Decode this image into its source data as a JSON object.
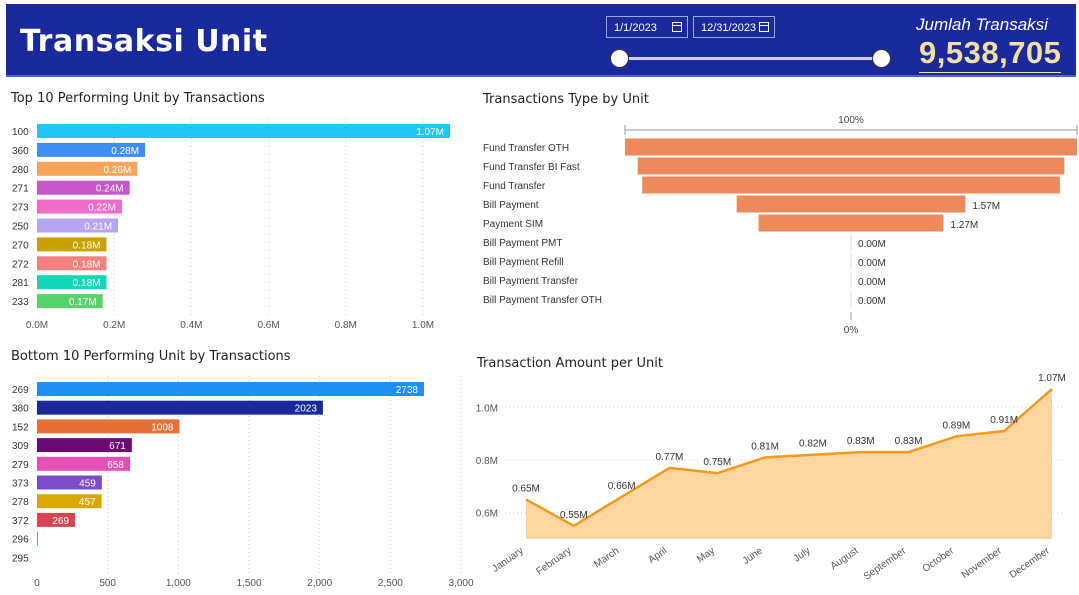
{
  "header": {
    "title": "Transaksi Unit",
    "date_start": "1/1/2023",
    "date_end": "12/31/2023",
    "kpi_label": "Jumlah Transaksi",
    "kpi_value": "9,538,705",
    "background": "#1a2a9c",
    "kpi_color": "#f4e1a1"
  },
  "chart_data": [
    {
      "type": "bar",
      "title": "Top 10 Performing Unit by Transactions",
      "orientation": "horizontal",
      "categories": [
        "100",
        "360",
        "280",
        "271",
        "273",
        "250",
        "270",
        "272",
        "281",
        "233"
      ],
      "values": [
        1.07,
        0.28,
        0.26,
        0.24,
        0.22,
        0.21,
        0.18,
        0.18,
        0.18,
        0.17
      ],
      "labels": [
        "1.07M",
        "0.28M",
        "0.26M",
        "0.24M",
        "0.22M",
        "0.21M",
        "0.18M",
        "0.18M",
        "0.18M",
        "0.17M"
      ],
      "colors": [
        "#1fc7f5",
        "#3d8ef0",
        "#f7a35a",
        "#c458c6",
        "#ee6dc9",
        "#b5a4f0",
        "#c9a200",
        "#f5817e",
        "#14d6b8",
        "#56d46a"
      ],
      "xlim": [
        0,
        1.07
      ],
      "xticks": [
        "0.0M",
        "0.2M",
        "0.4M",
        "0.6M",
        "0.8M",
        "1.0M"
      ],
      "xtick_values": [
        0,
        0.2,
        0.4,
        0.6,
        0.8,
        1.0
      ],
      "grid": true
    },
    {
      "type": "bar",
      "title": "Transactions Type by Unit",
      "orientation": "funnel",
      "categories": [
        "Fund Transfer OTH",
        "Fund Transfer BI Fast",
        "Fund Transfer",
        "Bill Payment",
        "Payment SIM",
        "Bill Payment PMT",
        "Bill Payment Refill",
        "Bill Payment Transfer",
        "Bill Payment Transfer OTH"
      ],
      "values": [
        100,
        94.4,
        92.4,
        50.6,
        40.9,
        0,
        0,
        0,
        0
      ],
      "labels": [
        "",
        "",
        "",
        "1.57M",
        "1.27M",
        "0.00M",
        "0.00M",
        "0.00M",
        "0.00M"
      ],
      "top_label": "100%",
      "bottom_label": "0%",
      "color": "#ec8a5c"
    },
    {
      "type": "bar",
      "title": "Bottom 10 Performing Unit by Transactions",
      "orientation": "horizontal",
      "categories": [
        "269",
        "380",
        "152",
        "309",
        "279",
        "373",
        "278",
        "372",
        "296",
        "295"
      ],
      "values": [
        2738,
        2023,
        1008,
        671,
        658,
        459,
        457,
        269,
        2,
        0
      ],
      "labels": [
        "2738",
        "2023",
        "1008",
        "671",
        "658",
        "459",
        "457",
        "269",
        "",
        ""
      ],
      "colors": [
        "#1d8ff5",
        "#1a2a9c",
        "#e8703a",
        "#6b0a73",
        "#e64fb5",
        "#7b4ec8",
        "#dba600",
        "#d94452",
        "#14c8b0",
        "#cccccc"
      ],
      "xlim": [
        0,
        3000
      ],
      "xticks": [
        "0",
        "500",
        "1,000",
        "1,500",
        "2,000",
        "2,500",
        "3,000"
      ],
      "xtick_values": [
        0,
        500,
        1000,
        1500,
        2000,
        2500,
        3000
      ],
      "grid": true
    },
    {
      "type": "area",
      "title": "Transaction Amount per Unit",
      "x": [
        "January",
        "February",
        "March",
        "April",
        "May",
        "June",
        "July",
        "August",
        "September",
        "October",
        "November",
        "December"
      ],
      "values": [
        0.65,
        0.55,
        0.66,
        0.77,
        0.75,
        0.81,
        0.82,
        0.83,
        0.83,
        0.89,
        0.91,
        1.07
      ],
      "labels": [
        "0.65M",
        "0.55M",
        "0.66M",
        "0.77M",
        "0.75M",
        "0.81M",
        "0.82M",
        "0.83M",
        "0.83M",
        "0.89M",
        "0.91M",
        "1.07M"
      ],
      "ylim": [
        0.5,
        1.1
      ],
      "yticks": [
        "0.6M",
        "0.8M",
        "1.0M"
      ],
      "ytick_values": [
        0.6,
        0.8,
        1.0
      ],
      "line_color": "#f39a1e",
      "fill_color": "#fdd5a0",
      "grid": true
    }
  ]
}
